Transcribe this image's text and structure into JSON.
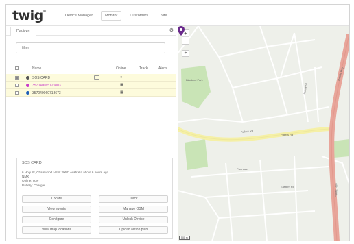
{
  "app": {
    "logo": "twig",
    "logo_mark": "®",
    "nav": [
      "Device Manager",
      "Monitor",
      "Customers",
      "Site"
    ],
    "active_nav": "Monitor"
  },
  "devices": {
    "tab_label": "Devices",
    "filter_placeholder": "filter",
    "columns": [
      "Name",
      "Online",
      "Track",
      "Alerts"
    ],
    "rows": [
      {
        "name": "SOS CARD",
        "online": "●",
        "dot_color": "#555555",
        "text_color": "#555555",
        "checked": true
      },
      {
        "name": "357040065125003",
        "online": "▦",
        "dot_color": "#c93cc9",
        "text_color": "#c93cc9",
        "checked": false
      },
      {
        "name": "357040060718673",
        "online": "▦",
        "dot_color": "#1f5fb8",
        "text_color": "#555555",
        "checked": false
      }
    ]
  },
  "detail": {
    "title": "SOS CARD",
    "lines": [
      "6 Holy St, Chatswood NSW 2067, Australia about 6 hours ago",
      "NMX",
      "Online: now",
      "Battery: Charger"
    ],
    "buttons": [
      "Locate",
      "Track",
      "View events",
      "Manage OSM",
      "Configure",
      "Unlock Device",
      "View map locations",
      "Upload action plan"
    ]
  },
  "map": {
    "zoom_in": "+",
    "zoom_out": "−",
    "locate": "⌖",
    "scale": "500 m",
    "marker_color": "#6a2a8c",
    "road_major_color": "#e8a59a",
    "road_secondary_color": "#f5f0a6",
    "park_color": "#c9e4b6",
    "street_labels": [
      "Fullers Rd",
      "Fullers Rd",
      "Pacific Hwy",
      "Pacific Hwy",
      "Blaxland Park",
      "Park Ave",
      "Eastern Rd",
      "Archer St"
    ]
  }
}
